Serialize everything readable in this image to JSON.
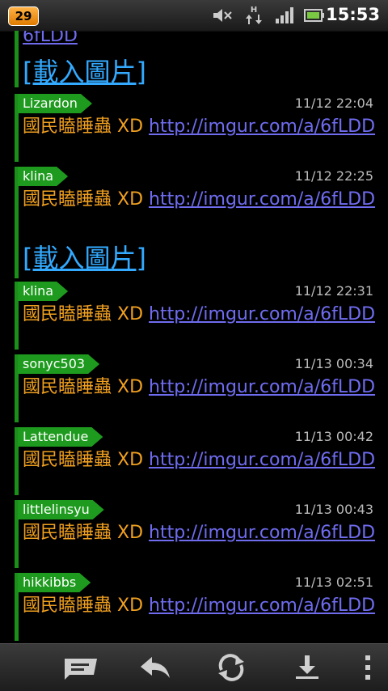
{
  "statusbar": {
    "notification_count": "29",
    "time": "15:53"
  },
  "content": {
    "top_partial_link": "6fLDD",
    "load_image_label": "[載入圖片]",
    "entries": [
      {
        "user": "Lizardon",
        "time": "11/12 22:04",
        "text": "國民瞌睡蟲 XD ",
        "link": "http://imgur.com/a/6fLDD"
      },
      {
        "user": "klina",
        "time": "11/12 22:25",
        "text": "國民瞌睡蟲 XD ",
        "link": "http://imgur.com/a/6fLDD"
      },
      {
        "user": "klina",
        "time": "11/12 22:31",
        "text": "國民瞌睡蟲 XD ",
        "link": "http://imgur.com/a/6fLDD"
      },
      {
        "user": "sonyc503",
        "time": "11/13 00:34",
        "text": "國民瞌睡蟲 XD ",
        "link": "http://imgur.com/a/6fLDD"
      },
      {
        "user": "Lattendue",
        "time": "11/13 00:42",
        "text": "國民瞌睡蟲 XD ",
        "link": "http://imgur.com/a/6fLDD"
      },
      {
        "user": "littlelinsyu",
        "time": "11/13 00:43",
        "text": "國民瞌睡蟲 XD ",
        "link": "http://imgur.com/a/6fLDD"
      },
      {
        "user": "hikkibbs",
        "time": "11/13 02:51",
        "text": "國民瞌睡蟲 XD ",
        "link": "http://imgur.com/a/6fLDD"
      }
    ]
  },
  "bottombar": {
    "icons": [
      "compose-icon",
      "reply-icon",
      "refresh-icon",
      "download-icon",
      "overflow-menu-icon"
    ]
  },
  "colors": {
    "tag_green": "#1e9b1e",
    "message_orange": "#f0a020",
    "link_blue": "#6f6cf0",
    "load_image_blue": "#33aaff"
  }
}
